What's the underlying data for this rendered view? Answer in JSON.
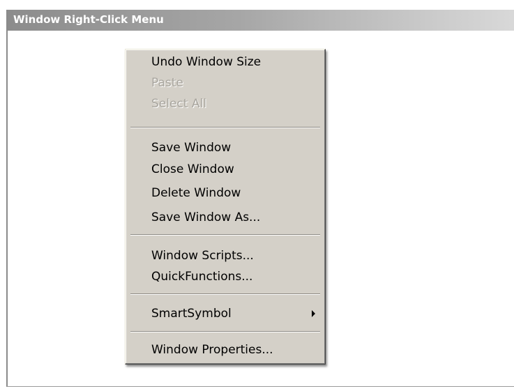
{
  "window": {
    "title": "Window Right-Click Menu"
  },
  "context_menu": {
    "items": [
      {
        "label": "Undo Window Size",
        "enabled": true
      },
      {
        "label": "Paste",
        "enabled": false
      },
      {
        "label": "Select All",
        "enabled": false
      },
      {
        "label": "Save Window",
        "enabled": true
      },
      {
        "label": "Close Window",
        "enabled": true
      },
      {
        "label": "Delete Window",
        "enabled": true
      },
      {
        "label": "Save Window As...",
        "enabled": true
      },
      {
        "label": "Window Scripts...",
        "enabled": true
      },
      {
        "label": "QuickFunctions...",
        "enabled": true
      },
      {
        "label": "SmartSymbol",
        "enabled": true,
        "submenu": true,
        "icon": "submenu-arrow-icon"
      },
      {
        "label": "Window Properties...",
        "enabled": true
      }
    ]
  },
  "colors": {
    "menu_background": "#d4d0c8",
    "disabled_text": "#a8a59e",
    "titlebar_start": "#8c8c8c",
    "titlebar_end": "#d9d9d9"
  }
}
